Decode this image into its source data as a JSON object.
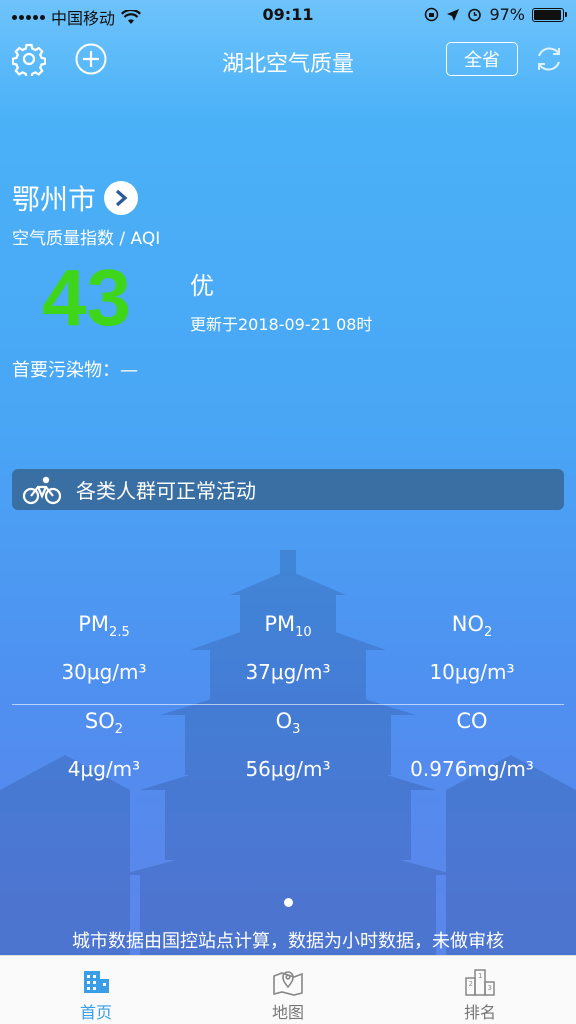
{
  "status_bar": {
    "carrier": "中国移动",
    "time": "09:11",
    "battery_percent": "97%",
    "battery_level": 0.97
  },
  "nav": {
    "title": "湖北空气质量",
    "province_button": "全省",
    "icons": [
      "gear-icon",
      "plus-icon",
      "refresh-icon"
    ]
  },
  "city": {
    "name": "鄂州市",
    "aqi_label": "空气质量指数 / AQI",
    "aqi_value": "43",
    "aqi_level": "优",
    "update_time": "更新于2018-09-21 08时",
    "primary_pollutant": "首要污染物：—",
    "aqi_color": "#3ed51a"
  },
  "advice": {
    "icon": "bicycle-icon",
    "text": "各类人群可正常活动"
  },
  "pollutants": {
    "row1": [
      {
        "name": "PM",
        "sub": "2.5",
        "value": "30μg/m³"
      },
      {
        "name": "PM",
        "sub": "10",
        "value": "37μg/m³"
      },
      {
        "name": "NO",
        "sub": "2",
        "value": "10μg/m³"
      }
    ],
    "row2": [
      {
        "name": "SO",
        "sub": "2",
        "value": "4μg/m³"
      },
      {
        "name": "O",
        "sub": "3",
        "value": "56μg/m³"
      },
      {
        "name": "CO",
        "sub": "",
        "value": "0.976mg/m³"
      }
    ]
  },
  "footnote": "城市数据由国控站点计算，数据为小时数据，未做审核",
  "tabs": [
    {
      "label": "首页",
      "icon": "building-icon",
      "active": true
    },
    {
      "label": "地图",
      "icon": "map-icon",
      "active": false
    },
    {
      "label": "排名",
      "icon": "podium-icon",
      "active": false
    }
  ],
  "colors": {
    "accent": "#3a9ee6",
    "advice_bar": "#3a6fa4"
  }
}
